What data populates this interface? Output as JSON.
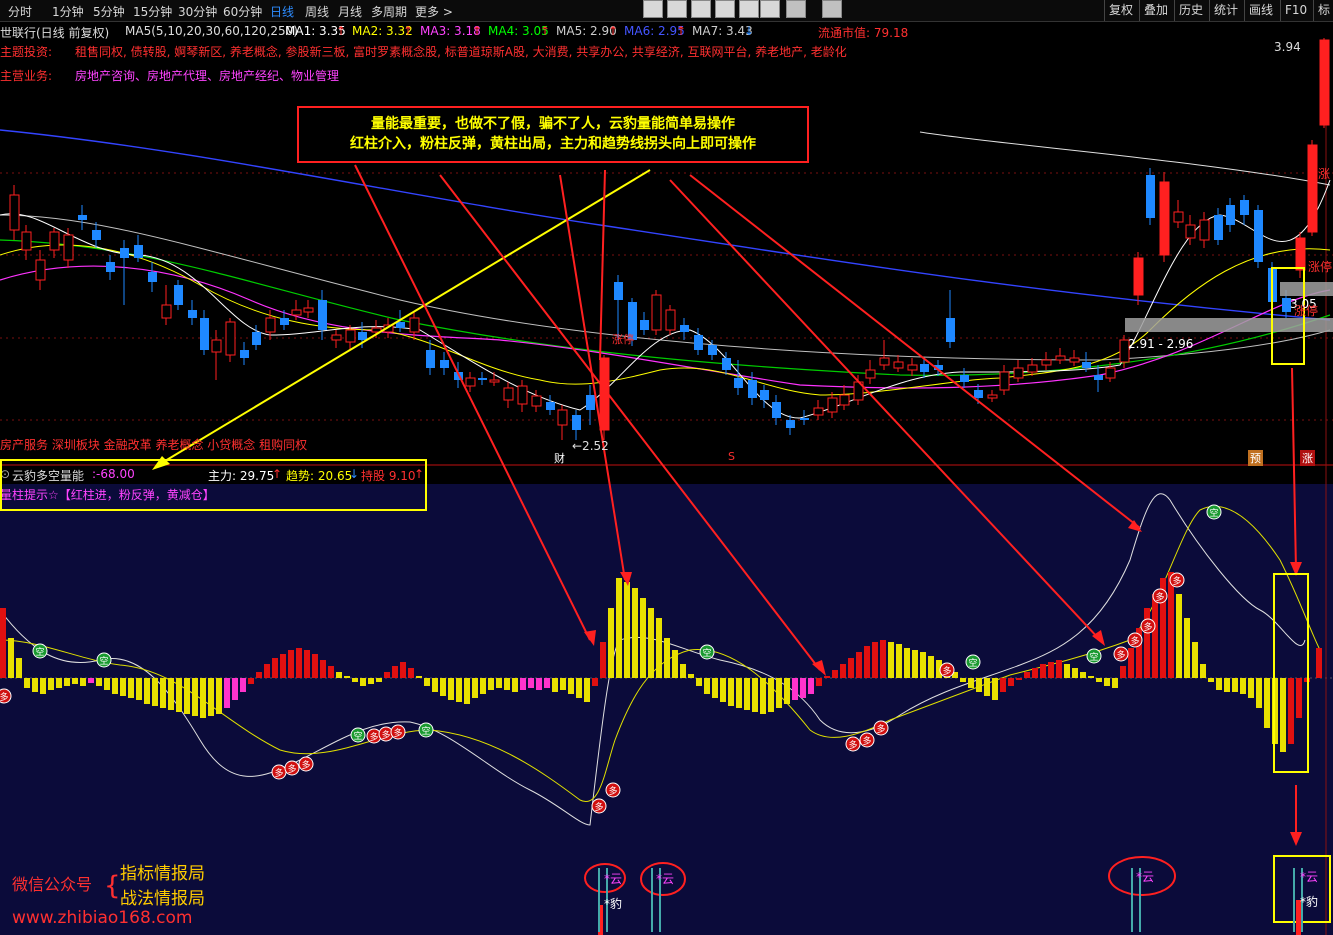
{
  "toolbar": {
    "timeframes": [
      "分时",
      "1分钟",
      "5分钟",
      "15分钟",
      "30分钟",
      "60分钟",
      "日线",
      "周线",
      "月线",
      "多周期",
      "更多 >"
    ],
    "active": "日线",
    "right_buttons": [
      "复权",
      "叠加",
      "历史",
      "统计",
      "画线",
      "F10",
      "标"
    ]
  },
  "stock": {
    "title": "世联行(日线 前复权)",
    "ma_params": "MA5(5,10,20,30,60,120,250)",
    "ma": [
      {
        "label": "MA1: 3.35",
        "arrow": "↑",
        "color": "#ffffff"
      },
      {
        "label": "MA2: 3.32",
        "arrow": "↑",
        "color": "#ffff00"
      },
      {
        "label": "MA3: 3.18",
        "arrow": "↑",
        "color": "#ff44ff"
      },
      {
        "label": "MA4: 3.05",
        "arrow": "↑",
        "color": "#00ff00"
      },
      {
        "label": "MA5: 2.90",
        "arrow": "↑",
        "color": "#cccccc"
      },
      {
        "label": "MA6: 2.95",
        "arrow": "↑",
        "color": "#4455ff"
      },
      {
        "label": "MA7: 3.43",
        "arrow": "↓",
        "color": "#cccccc"
      }
    ],
    "market_cap": "流通市值: 79.18",
    "theme_label": "主题投资:",
    "themes": "租售同权, 债转股, 婀琴新区, 养老概念, 参股新三板, 富时罗素概念股, 标普道琼斯A股, 大消费, 共享办公, 共享经济, 互联网平台, 养老地产, 老龄化",
    "business_label": "主营业务:",
    "business": "房地产咨询、房地产代理、房地产经纪、物业管理",
    "bottom_concepts": "房产服务 深圳板块 金融改革 养老概念 小贷概念 租购同权",
    "price_hi": "3.94",
    "price_low": "←2.52",
    "range_label": "2.91 - 2.96",
    "price_label2": "3.05",
    "limit_up1": "涨停",
    "limit_up2": "涨停",
    "zhang": "涨",
    "event_cai": "财",
    "event_s": "S",
    "event_yu": "预",
    "event_zhang": "涨",
    "mark_zhangting": "涨停"
  },
  "annotation": {
    "line1": "量能最重要，也做不了假，骗不了人，云豹量能简单易操作",
    "line2": "红柱介入，粉柱反弹，黄柱出局，主力和趋势线拐头向上即可操作"
  },
  "indicator": {
    "name": "云豹多空量能",
    "value": ":-68.00",
    "zhuli": "主力: 29.75",
    "zhuli_arrow": "↑",
    "qushi": "趋势: 20.65",
    "qushi_arrow": "↓",
    "chigu": "持股  9.10",
    "chigu_arrow": "↑",
    "tip": "量柱提示☆【红柱进，粉反弹，黄减仓】"
  },
  "badges": {
    "kong": "空",
    "duo": "多"
  },
  "bottom_marks": {
    "yun": "*云",
    "bao": "*豹"
  },
  "watermark": {
    "label": "微信公众号",
    "name1": "指标情报局",
    "name2": "战法情报局",
    "url": "www.zhibiao168.com"
  },
  "colors": {
    "up": "#ff2020",
    "down": "#1e88ff",
    "yellow": "#ffff00",
    "pink": "#ff33cc",
    "indicator_bg": "#0b0b3a"
  }
}
